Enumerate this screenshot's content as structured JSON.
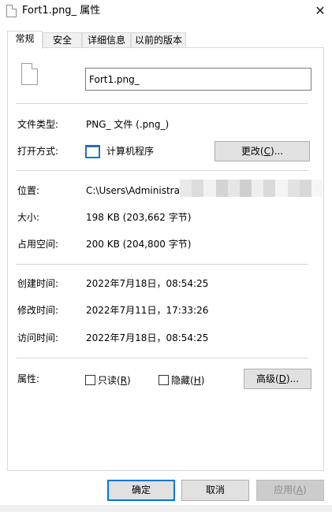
{
  "window": {
    "title": "Fort1.png_ 属性",
    "close_glyph": "✕"
  },
  "tabs": [
    {
      "label": "常规",
      "active": true
    },
    {
      "label": "安全",
      "active": false
    },
    {
      "label": "详细信息",
      "active": false
    },
    {
      "label": "以前的版本",
      "active": false
    }
  ],
  "general": {
    "file_name": "Fort1.png_",
    "type_label": "文件类型:",
    "type_value": "PNG_ 文件 (.png_)",
    "opens_label": "打开方式:",
    "opens_value": "计算机程序",
    "change_button": {
      "text": "更改(",
      "key": "C",
      "suffix": ")..."
    },
    "location_label": "位置:",
    "location_value": "C:\\Users\\Administrat",
    "size_label": "大小:",
    "size_value": "198 KB (203,662 字节)",
    "disk_label": "占用空间:",
    "disk_value": "200 KB (204,800 字节)",
    "created_label": "创建时间:",
    "created_value": "2022年7月18日，08:54:25",
    "modified_label": "修改时间:",
    "modified_value": "2022年7月11日，17:33:26",
    "accessed_label": "访问时间:",
    "accessed_value": "2022年7月18日，08:54:25",
    "attrs_label": "属性:",
    "readonly": {
      "text": "只读(",
      "key": "R",
      "suffix": ")",
      "checked": false
    },
    "hidden": {
      "text": "隐藏(",
      "key": "H",
      "suffix": ")",
      "checked": false
    },
    "advanced_button": {
      "text": "高级(",
      "key": "D",
      "suffix": ")..."
    }
  },
  "footer": {
    "ok": "确定",
    "cancel": "取消",
    "apply": {
      "text": "应用(",
      "key": "A",
      "suffix": ")"
    }
  },
  "colors": {
    "accent": "#0078d7",
    "button_face": "#e1e1e1",
    "border": "#d9d9d9",
    "disabled_text": "#8d8d8d"
  }
}
